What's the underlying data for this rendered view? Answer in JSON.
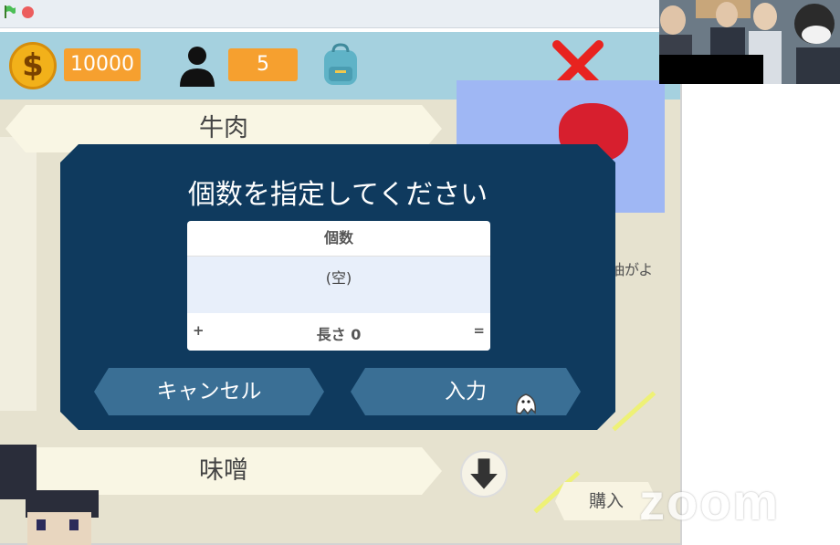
{
  "top_bar": {
    "money_icon": "dollar-coin-icon",
    "money_glyph": "$",
    "money_value": "10000",
    "people_icon": "person-icon",
    "people_value": "5",
    "bag_icon": "backpack-icon",
    "close_icon": "red-x-icon"
  },
  "items": [
    {
      "label": "牛肉"
    },
    {
      "label": "味噌"
    }
  ],
  "description_fragment": "抽がよ",
  "buy_label": "購入",
  "dialog": {
    "title": "個数を指定してください",
    "list_header": "個数",
    "list_item": "(空)",
    "add_symbol": "+",
    "length_label": "長さ 0",
    "resize_symbol": "=",
    "cancel_label": "キャンセル",
    "enter_label": "入力"
  },
  "watermark": "zoom",
  "colors": {
    "dialog_bg": "#0f3a5e",
    "button_bg": "#3a6f95",
    "stat_bg": "#f6a02f",
    "topbar_bg": "#a5d1df",
    "close_red": "#e8231f"
  }
}
